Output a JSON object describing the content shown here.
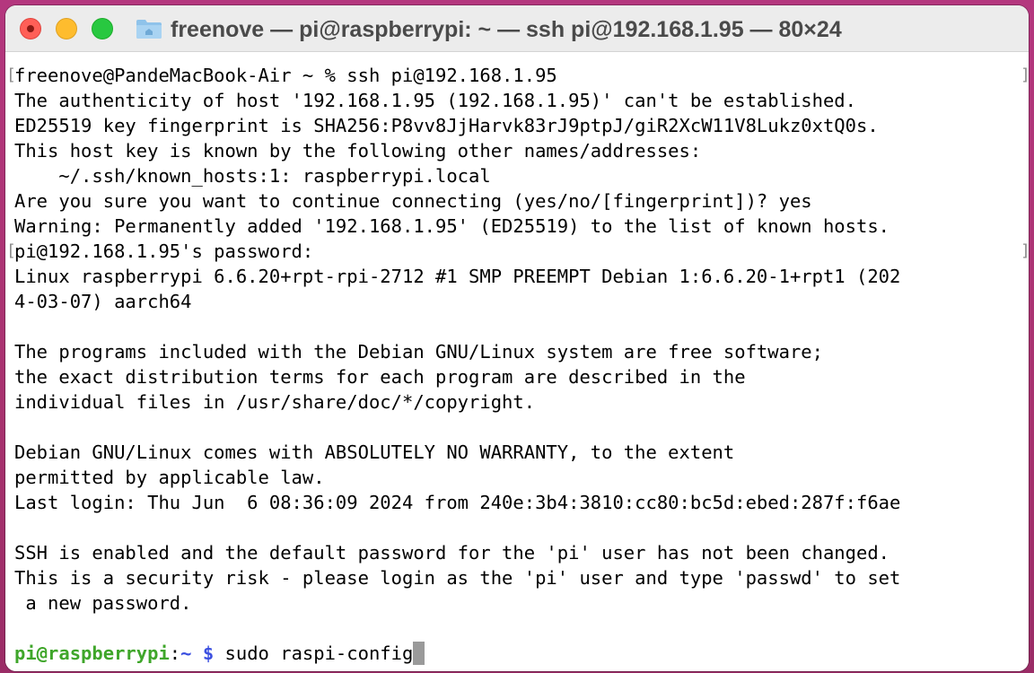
{
  "window": {
    "title": "freenove — pi@raspberrypi: ~ — ssh pi@192.168.1.95 — 80×24",
    "title_icon": "folder-icon"
  },
  "colors": {
    "close": "#ff5f57",
    "minimize": "#febc2e",
    "zoom": "#28c840",
    "prompt_user": "#3fa62a",
    "prompt_path": "#3b4fe0",
    "cursor": "#9a9a9a"
  },
  "terminal": {
    "lines": [
      "freenove@PandeMacBook-Air ~ % ssh pi@192.168.1.95",
      "The authenticity of host '192.168.1.95 (192.168.1.95)' can't be established.",
      "ED25519 key fingerprint is SHA256:P8vv8JjHarvk83rJ9ptpJ/giR2XcW11V8Lukz0xtQ0s.",
      "This host key is known by the following other names/addresses:",
      "    ~/.ssh/known_hosts:1: raspberrypi.local",
      "Are you sure you want to continue connecting (yes/no/[fingerprint])? yes",
      "Warning: Permanently added '192.168.1.95' (ED25519) to the list of known hosts.",
      "pi@192.168.1.95's password: ",
      "Linux raspberrypi 6.6.20+rpt-rpi-2712 #1 SMP PREEMPT Debian 1:6.6.20-1+rpt1 (202",
      "4-03-07) aarch64",
      "",
      "The programs included with the Debian GNU/Linux system are free software;",
      "the exact distribution terms for each program are described in the",
      "individual files in /usr/share/doc/*/copyright.",
      "",
      "Debian GNU/Linux comes with ABSOLUTELY NO WARRANTY, to the extent",
      "permitted by applicable law.",
      "Last login: Thu Jun  6 08:36:09 2024 from 240e:3b4:3810:cc80:bc5d:ebed:287f:f6ae",
      "",
      "SSH is enabled and the default password for the 'pi' user has not been changed.",
      "This is a security risk - please login as the 'pi' user and type 'passwd' to set",
      " a new password.",
      ""
    ],
    "prompt": {
      "user_host": "pi@raspberrypi",
      "separator": ":",
      "path": "~",
      "symbol": "$",
      "command": "sudo raspi-config"
    },
    "marks": {
      "left": "[",
      "right": "]"
    }
  }
}
